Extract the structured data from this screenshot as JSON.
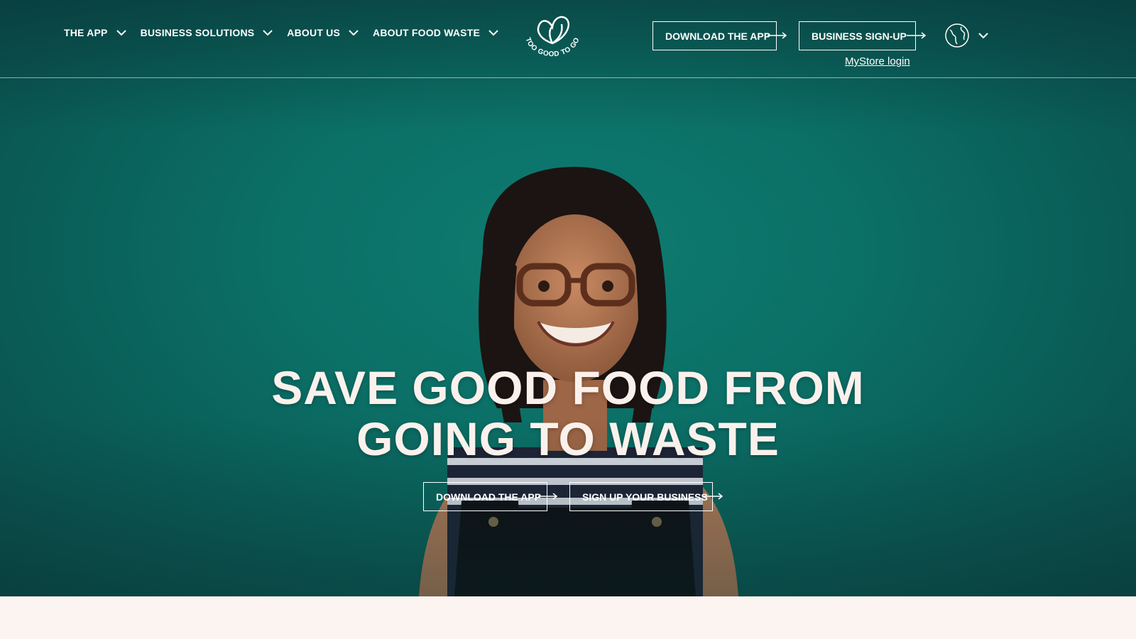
{
  "nav": {
    "items": [
      {
        "label": "THE APP"
      },
      {
        "label": "BUSINESS SOLUTIONS"
      },
      {
        "label": "ABOUT US"
      },
      {
        "label": "ABOUT FOOD WASTE"
      }
    ]
  },
  "logo": {
    "text": "TOO GOOD TO GO"
  },
  "header_actions": {
    "download_app": "DOWNLOAD THE APP",
    "business_signup": "BUSINESS SIGN-UP",
    "mystore_login": "MyStore login"
  },
  "hero": {
    "title_line1": "SAVE GOOD FOOD FROM",
    "title_line2": "GOING TO WASTE",
    "download_app": "DOWNLOAD THE APP",
    "sign_up_business": "SIGN UP YOUR BUSINESS"
  },
  "colors": {
    "hero_teal": "#0b6f66",
    "text_light": "#fbf1ec",
    "page_bg": "#fbf4f0"
  }
}
